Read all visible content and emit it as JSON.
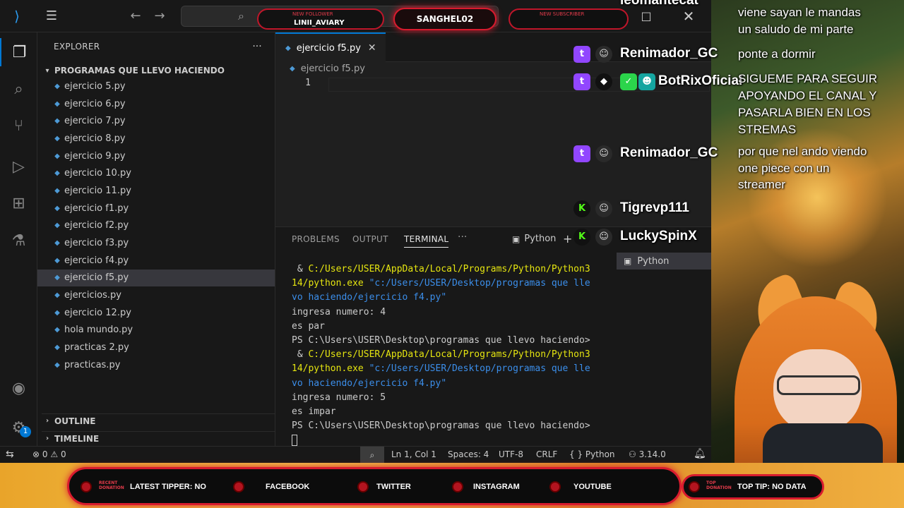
{
  "window": {
    "explorer_title": "EXPLORER",
    "folder_name": "PROGRAMAS QUE LLEVO HACIENDO",
    "outline_label": "OUTLINE",
    "timeline_label": "TIMELINE"
  },
  "files": [
    {
      "name": "ejercicio 5.py",
      "selected": false
    },
    {
      "name": "ejercicio 6.py",
      "selected": false
    },
    {
      "name": "ejercicio 7.py",
      "selected": false
    },
    {
      "name": "ejercicio 8.py",
      "selected": false
    },
    {
      "name": "ejercicio 9.py",
      "selected": false
    },
    {
      "name": "ejercicio 10.py",
      "selected": false
    },
    {
      "name": "ejercicio 11.py",
      "selected": false
    },
    {
      "name": "ejercicio f1.py",
      "selected": false
    },
    {
      "name": "ejercicio f2.py",
      "selected": false
    },
    {
      "name": "ejercicio f3.py",
      "selected": false
    },
    {
      "name": "ejercicio f4.py",
      "selected": false
    },
    {
      "name": "ejercicio f5.py",
      "selected": true
    },
    {
      "name": "ejercicios.py",
      "selected": false
    },
    {
      "name": "ejercicio 12.py",
      "selected": false
    },
    {
      "name": "hola mundo.py",
      "selected": false
    },
    {
      "name": "practicas 2.py",
      "selected": false
    },
    {
      "name": "practicas.py",
      "selected": false
    }
  ],
  "editor": {
    "tab_label": "ejercicio f5.py",
    "breadcrumb": "ejercicio f5.py",
    "line_number": "1"
  },
  "panel": {
    "tab_problems": "PROBLEMS",
    "tab_output": "OUTPUT",
    "tab_terminal": "TERMINAL",
    "shell_label": "Python",
    "terminal_list_item": "Python",
    "terminal_lines": [
      {
        "segments": [
          {
            "t": " & ",
            "c": ""
          },
          {
            "t": "C:/Users/USER/AppData/Local/Programs/Python/Python3",
            "c": "yellow"
          }
        ]
      },
      {
        "segments": [
          {
            "t": "14/python.exe",
            "c": "yellow"
          },
          {
            "t": " ",
            "c": ""
          },
          {
            "t": "\"c:/Users/USER/Desktop/programas que lle",
            "c": "blue"
          }
        ]
      },
      {
        "segments": [
          {
            "t": "vo haciendo/ejercicio f4.py\"",
            "c": "blue"
          }
        ]
      },
      {
        "segments": [
          {
            "t": "ingresa numero: 4",
            "c": ""
          }
        ]
      },
      {
        "segments": [
          {
            "t": "es par",
            "c": ""
          }
        ]
      },
      {
        "segments": [
          {
            "t": "PS C:\\Users\\USER\\Desktop\\programas que llevo haciendo>",
            "c": ""
          }
        ]
      },
      {
        "segments": [
          {
            "t": " & ",
            "c": ""
          },
          {
            "t": "C:/Users/USER/AppData/Local/Programs/Python/Python3",
            "c": "yellow"
          }
        ]
      },
      {
        "segments": [
          {
            "t": "14/python.exe",
            "c": "yellow"
          },
          {
            "t": " ",
            "c": ""
          },
          {
            "t": "\"c:/Users/USER/Desktop/programas que lle",
            "c": "blue"
          }
        ]
      },
      {
        "segments": [
          {
            "t": "vo haciendo/ejercicio f4.py\"",
            "c": "blue"
          }
        ]
      },
      {
        "segments": [
          {
            "t": "ingresa numero: 5",
            "c": ""
          }
        ]
      },
      {
        "segments": [
          {
            "t": "es impar",
            "c": ""
          }
        ]
      },
      {
        "segments": [
          {
            "t": "PS C:\\Users\\USER\\Desktop\\programas que llevo haciendo>",
            "c": ""
          }
        ]
      }
    ]
  },
  "statusbar": {
    "errors": "0",
    "warnings": "0",
    "position": "Ln 1, Col 1",
    "spaces": "Spaces: 4",
    "encoding": "UTF-8",
    "eol": "CRLF",
    "language": "Python",
    "python_version": "3.14.0",
    "settings_badge": "1"
  },
  "stream": {
    "alert_follower_label": "NEW FOLLOWER",
    "alert_follower_name": "LINII_AVIARY",
    "streamer_name": "SANGHEL02",
    "alert_subscriber_label": "NEW SUBSCRIBER",
    "chat": [
      {
        "user": "leomantecat",
        "message_lines": [
          "viene sayan le mandas",
          "un saludo de mi parte"
        ]
      },
      {
        "user": "Renimador_GC",
        "message_lines": [
          "ponte a dormir"
        ]
      },
      {
        "user": "BotRixOficial",
        "message_lines": [
          "SIGUEME PARA SEGUIR",
          "APOYANDO EL CANAL Y",
          "PASARLA BIEN EN LOS",
          "STREMAS"
        ]
      },
      {
        "user": "Renimador_GC",
        "message_lines": [
          "por que nel ando viendo",
          "one piece con un",
          "streamer"
        ]
      },
      {
        "user": "Tigrevp111",
        "message_lines": []
      },
      {
        "user": "LuckySpinX",
        "message_lines": []
      }
    ],
    "bottom": {
      "recent_donation_label": "RECENT DONATION",
      "latest_tipper": "LATEST TIPPER: NO",
      "facebook": "FACEBOOK",
      "twitter": "TWITTER",
      "instagram": "INSTAGRAM",
      "youtube": "YOUTUBE",
      "top_donation_label": "TOP DONATION",
      "top_tip": "TOP TIP: NO DATA"
    }
  },
  "colors": {
    "accent": "#0078d4",
    "stream_red": "#d81b2e",
    "twitch_purple": "#9146ff",
    "kick_green": "#53fc18"
  }
}
